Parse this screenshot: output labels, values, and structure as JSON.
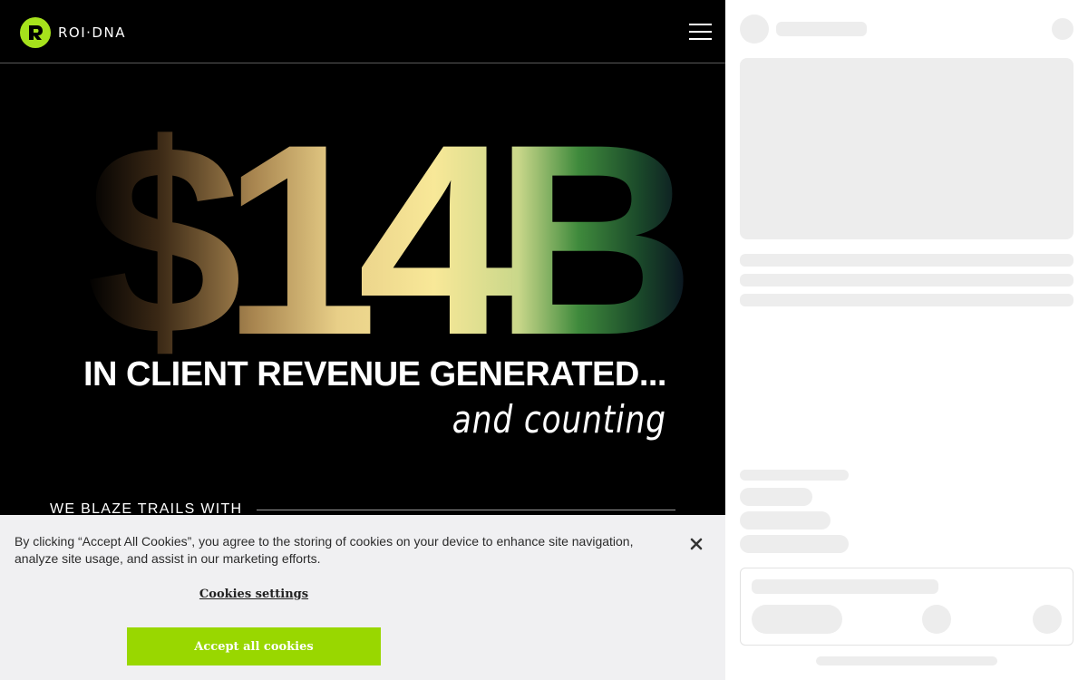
{
  "header": {
    "logo_text": "ROI·DNA",
    "logo_icon": "roi-dna-logo-icon",
    "menu_icon": "hamburger-menu-icon"
  },
  "hero": {
    "stat": "$14B",
    "headline": "IN CLIENT REVENUE GENERATED...",
    "script_line": "and counting",
    "trails_label": "WE BLAZE TRAILS WITH"
  },
  "cookie_banner": {
    "message": "By clicking “Accept All Cookies”, you agree to the storing of cookies on your device to enhance site navigation, analyze site usage, and assist in our marketing efforts.",
    "settings_label": "Cookies settings",
    "accept_label": "Accept all cookies",
    "close_icon": "close-icon",
    "accent_color": "#99d700"
  },
  "colors": {
    "brand_green": "#a6e21c",
    "background": "#000000",
    "skeleton": "#ededed"
  }
}
